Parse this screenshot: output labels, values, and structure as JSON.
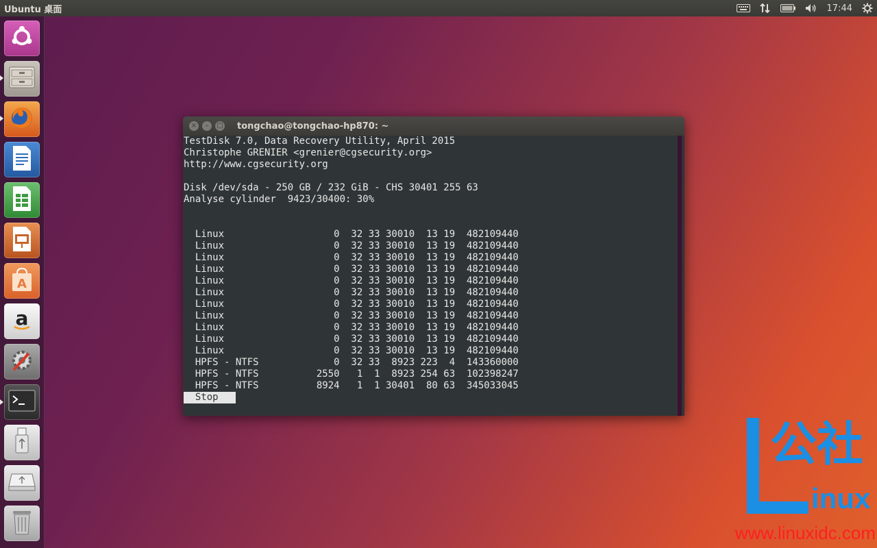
{
  "top_panel": {
    "title": "Ubuntu 桌面",
    "clock": "17:44",
    "indicators": [
      "keyboard-icon",
      "network-icon",
      "battery-icon",
      "volume-icon",
      "power-icon"
    ]
  },
  "launcher": {
    "items": [
      {
        "name": "ubuntu-dash",
        "icon": "ubuntu-logo-icon",
        "color": "#c54aa7"
      },
      {
        "name": "files",
        "icon": "file-cabinet-icon",
        "color": "#b9b4ad",
        "running": true
      },
      {
        "name": "firefox",
        "icon": "firefox-icon",
        "color": "#e96b1a",
        "running": true
      },
      {
        "name": "libreoffice-writer",
        "icon": "writer-icon",
        "color": "#2e6db5"
      },
      {
        "name": "libreoffice-calc",
        "icon": "calc-icon",
        "color": "#3e9a43"
      },
      {
        "name": "libreoffice-impress",
        "icon": "impress-icon",
        "color": "#c8642a"
      },
      {
        "name": "ubuntu-software",
        "icon": "software-bag-icon",
        "color": "#e77b3f"
      },
      {
        "name": "amazon",
        "icon": "amazon-icon",
        "color": "#e8e8e8"
      },
      {
        "name": "system-settings",
        "icon": "settings-gear-icon",
        "color": "#8a8a8a"
      },
      {
        "name": "terminal",
        "icon": "terminal-icon",
        "color": "#2c2c2c",
        "running": true
      },
      {
        "name": "usb-drive",
        "icon": "usb-icon",
        "color": "#d8d8d8"
      },
      {
        "name": "removable-drive",
        "icon": "drive-icon",
        "color": "#d0d0d0"
      },
      {
        "name": "trash",
        "icon": "trash-icon",
        "color": "#bdbdbd"
      }
    ]
  },
  "terminal": {
    "title": "tongchao@tongchao-hp870: ~",
    "header_lines": [
      "TestDisk 7.0, Data Recovery Utility, April 2015",
      "Christophe GRENIER <grenier@cgsecurity.org>",
      "http://www.cgsecurity.org",
      "",
      "Disk /dev/sda - 250 GB / 232 GiB - CHS 30401 255 63",
      "Analyse cylinder  9423/30400: 30%",
      "",
      ""
    ],
    "partitions": [
      {
        "type": "Linux",
        "start_c": "0",
        "start_h": "32",
        "start_s": "33",
        "end_c": "30010",
        "end_h": "13",
        "end_s": "19",
        "size": "482109440"
      },
      {
        "type": "Linux",
        "start_c": "0",
        "start_h": "32",
        "start_s": "33",
        "end_c": "30010",
        "end_h": "13",
        "end_s": "19",
        "size": "482109440"
      },
      {
        "type": "Linux",
        "start_c": "0",
        "start_h": "32",
        "start_s": "33",
        "end_c": "30010",
        "end_h": "13",
        "end_s": "19",
        "size": "482109440"
      },
      {
        "type": "Linux",
        "start_c": "0",
        "start_h": "32",
        "start_s": "33",
        "end_c": "30010",
        "end_h": "13",
        "end_s": "19",
        "size": "482109440"
      },
      {
        "type": "Linux",
        "start_c": "0",
        "start_h": "32",
        "start_s": "33",
        "end_c": "30010",
        "end_h": "13",
        "end_s": "19",
        "size": "482109440"
      },
      {
        "type": "Linux",
        "start_c": "0",
        "start_h": "32",
        "start_s": "33",
        "end_c": "30010",
        "end_h": "13",
        "end_s": "19",
        "size": "482109440"
      },
      {
        "type": "Linux",
        "start_c": "0",
        "start_h": "32",
        "start_s": "33",
        "end_c": "30010",
        "end_h": "13",
        "end_s": "19",
        "size": "482109440"
      },
      {
        "type": "Linux",
        "start_c": "0",
        "start_h": "32",
        "start_s": "33",
        "end_c": "30010",
        "end_h": "13",
        "end_s": "19",
        "size": "482109440"
      },
      {
        "type": "Linux",
        "start_c": "0",
        "start_h": "32",
        "start_s": "33",
        "end_c": "30010",
        "end_h": "13",
        "end_s": "19",
        "size": "482109440"
      },
      {
        "type": "Linux",
        "start_c": "0",
        "start_h": "32",
        "start_s": "33",
        "end_c": "30010",
        "end_h": "13",
        "end_s": "19",
        "size": "482109440"
      },
      {
        "type": "Linux",
        "start_c": "0",
        "start_h": "32",
        "start_s": "33",
        "end_c": "30010",
        "end_h": "13",
        "end_s": "19",
        "size": "482109440"
      },
      {
        "type": "HPFS - NTFS",
        "start_c": "0",
        "start_h": "32",
        "start_s": "33",
        "end_c": "8923",
        "end_h": "223",
        "end_s": "4",
        "size": "143360000"
      },
      {
        "type": "HPFS - NTFS",
        "start_c": "2550",
        "start_h": "1",
        "start_s": "1",
        "end_c": "8923",
        "end_h": "254",
        "end_s": "63",
        "size": "102398247"
      },
      {
        "type": "HPFS - NTFS",
        "start_c": "8924",
        "start_h": "1",
        "start_s": "1",
        "end_c": "30401",
        "end_h": "80",
        "end_s": "63",
        "size": "345033045"
      }
    ],
    "stop_label": "Stop"
  },
  "watermark": {
    "cn_text": "公社",
    "brand_text": "inux",
    "url": "www.linuxidc.com",
    "blue": "#1a8fe3",
    "red": "#ff1f1f"
  }
}
